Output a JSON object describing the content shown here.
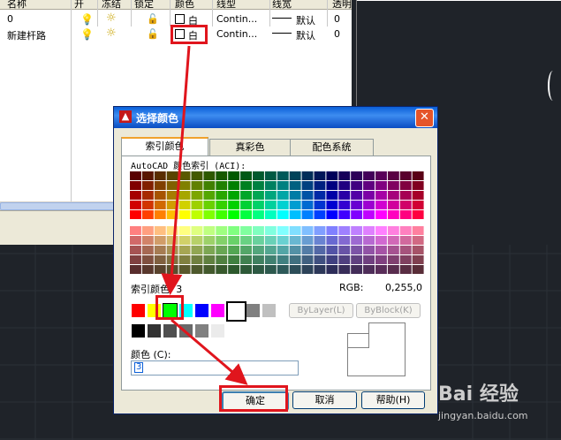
{
  "layer_panel": {
    "headers": [
      "名称",
      "开",
      "冻结",
      "锁定",
      "颜色",
      "线型",
      "线宽",
      "透明"
    ],
    "rows": [
      {
        "name": "0",
        "color": "白",
        "linetype": "Contin...",
        "lineweight": "默认",
        "transparency": "0"
      },
      {
        "name": "新建杆路",
        "color": "白",
        "linetype": "Contin...",
        "lineweight": "默认",
        "transparency": "0"
      }
    ]
  },
  "dialog": {
    "title": "选择颜色",
    "tabs": [
      "索引颜色",
      "真彩色",
      "配色系统"
    ],
    "aci_label": "AutoCAD 颜色索引 (ACI):",
    "index_label": "索引颜色: 3",
    "rgb_label": "RGB:",
    "rgb_value": "0,255,0",
    "bylayer": "ByLayer(L)",
    "byblock": "ByBlock(K)",
    "color_label": "颜色 (C):",
    "color_value": "3",
    "ok": "确定",
    "cancel": "取消",
    "help": "帮助(H)"
  },
  "watermark": {
    "brand": "Bai 经验",
    "url": "jingyan.baidu.com"
  },
  "colors": {
    "selected": "#00ff00",
    "titlebar": "#0a5fd8",
    "annotation": "#e0151d"
  }
}
